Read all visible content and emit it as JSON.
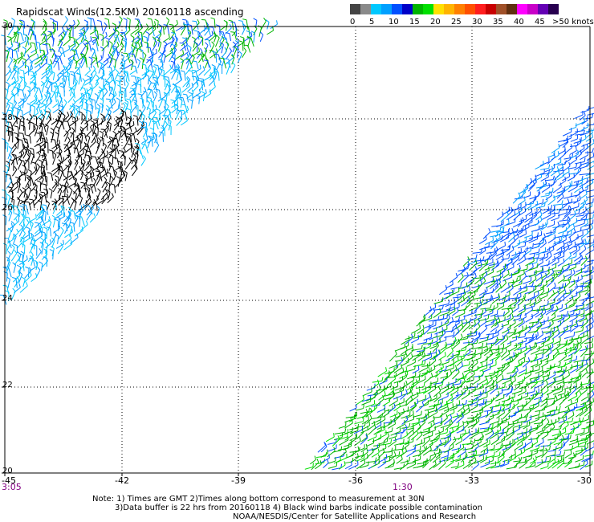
{
  "title": "Rapidscat Winds(12.5KM) 20160118 ascending",
  "colorbar": {
    "colors": [
      "#444444",
      "#8a8a8a",
      "#00c8ff",
      "#00a0ff",
      "#0050ff",
      "#0000c8",
      "#00b400",
      "#00e000",
      "#ffe000",
      "#ffb400",
      "#ff8000",
      "#ff5000",
      "#ff1e1e",
      "#c80000",
      "#a05028",
      "#603010",
      "#ff00ff",
      "#c800c8",
      "#6400b4",
      "#280050"
    ],
    "labels": [
      "0",
      "5",
      "10",
      "15",
      "20",
      "25",
      "30",
      "35",
      "40",
      "45",
      ">50 knots"
    ]
  },
  "lat_labels": [
    "30",
    "28",
    "26",
    "24",
    "22",
    "20"
  ],
  "lon_labels": [
    "-45",
    "-42",
    "-39",
    "-36",
    "-33",
    "-30"
  ],
  "time_labels": [
    "3:05",
    "1:30"
  ],
  "notes": [
    "Note: 1) Times are GMT 2)Times along bottom correspond to measurement at 30N",
    "3)Data buffer is 22 hrs from 20160118 4) Black wind barbs indicate possible contamination",
    "NOAA/NESDIS/Center for Satellite Applications and Research"
  ],
  "map": {
    "lat_range": [
      20,
      30
    ],
    "lon_range": [
      -45,
      -30
    ],
    "gridlines": true,
    "swaths": [
      "upper-left",
      "lower-right"
    ],
    "contamination_region": "upper-left swath near 27N -43W (black barbs)"
  }
}
